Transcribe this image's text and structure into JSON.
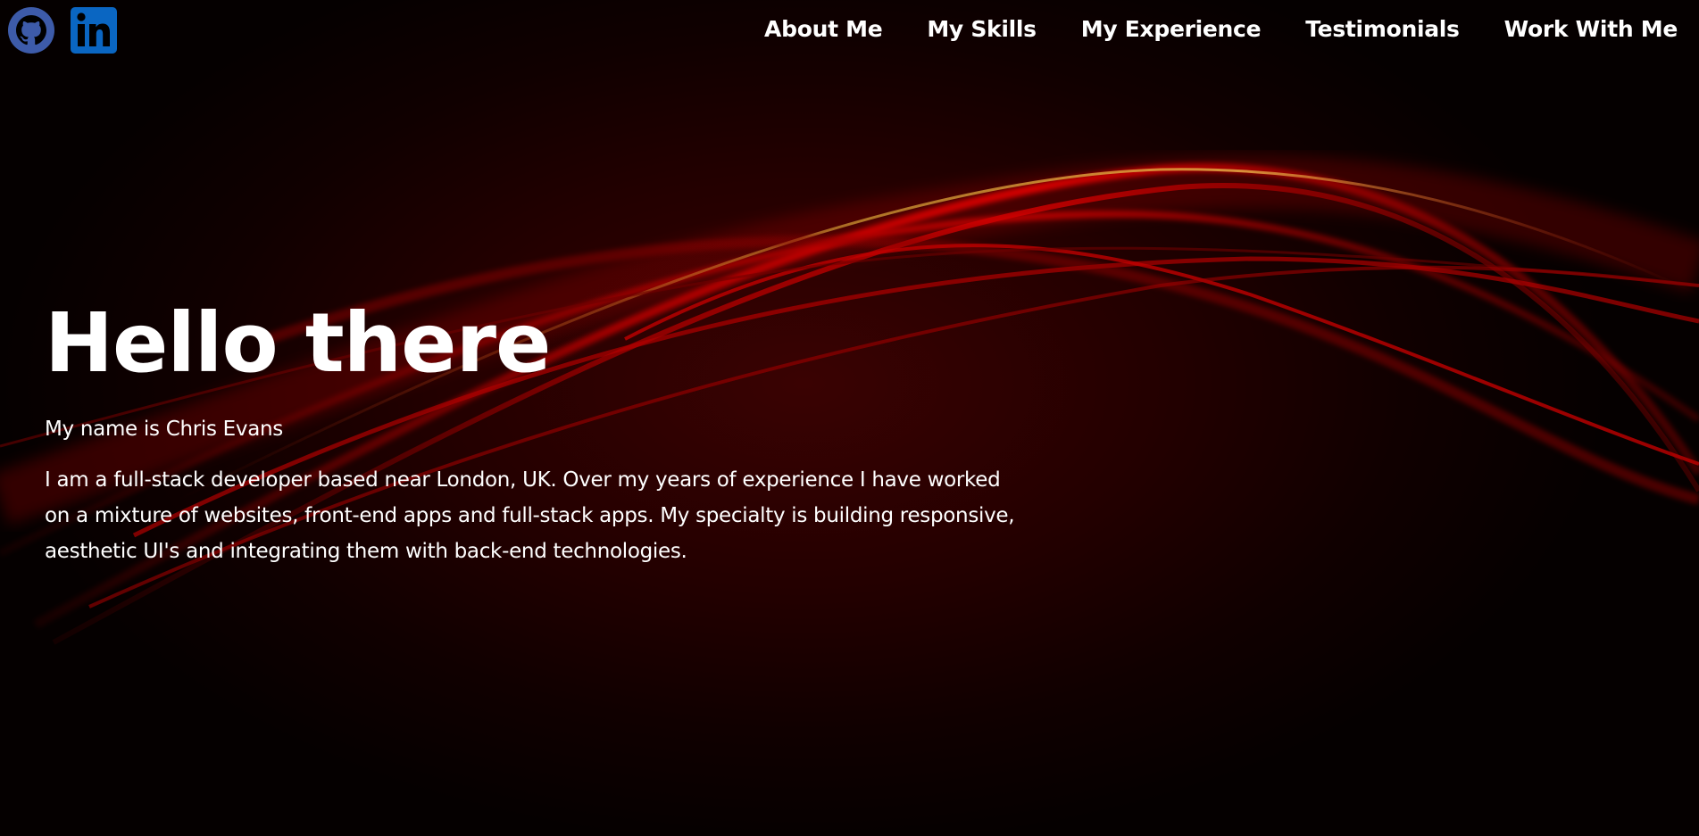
{
  "social": [
    {
      "label": "GitHub",
      "icon": "github-icon",
      "color": "#3c5ba8"
    },
    {
      "label": "LinkedIn",
      "icon": "linkedin-icon",
      "color": "#0a66c2"
    }
  ],
  "nav": {
    "items": [
      "About Me",
      "My Skills",
      "My Experience",
      "Testimonials",
      "Work With Me"
    ]
  },
  "hero": {
    "title": "Hello there",
    "name": "My name is Chris Evans",
    "bio": "I am a full-stack developer based near London, UK. Over my years of experience I have worked on a mixture of websites, front-end apps and full-stack apps. My specialty is building responsive, aesthetic UI's and integrating them with back-end technologies."
  },
  "theme": {
    "background": "#1a0000",
    "accent": "#c00000",
    "text": "#ffffff"
  }
}
